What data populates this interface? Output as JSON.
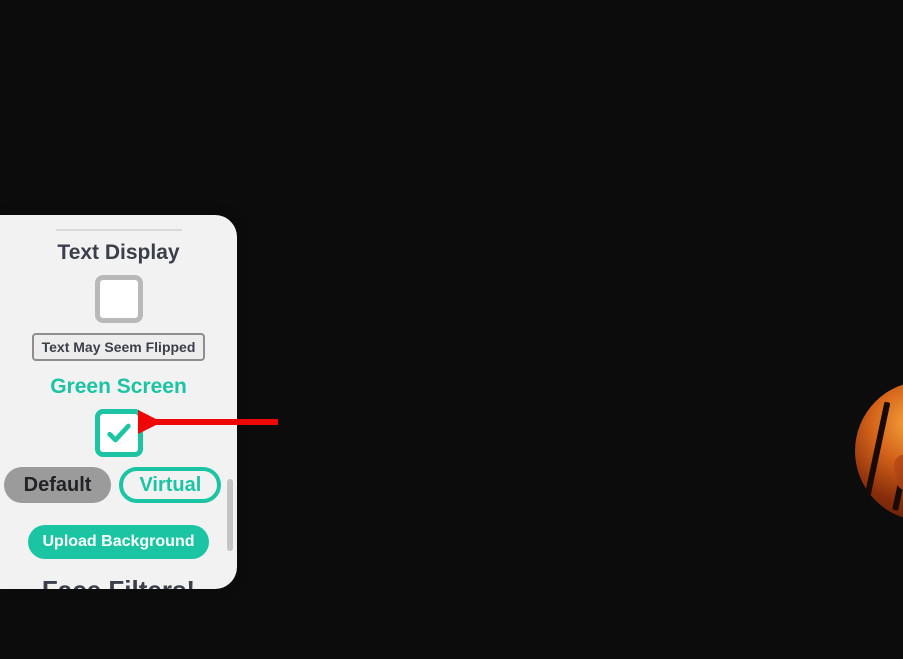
{
  "colors": {
    "teal": "#1bc4a2",
    "panel_bg": "#f2f2f2",
    "arrow": "#ef0707"
  },
  "sections": {
    "text_display": {
      "title": "Text Display",
      "checked": false,
      "warning": "Text May Seem Flipped"
    },
    "green_screen": {
      "title": "Green Screen",
      "checked": true,
      "options": {
        "default": "Default",
        "virtual": "Virtual",
        "active": "virtual"
      },
      "upload_label": "Upload Background"
    },
    "face_filters": {
      "title": "Face Filters!"
    }
  }
}
